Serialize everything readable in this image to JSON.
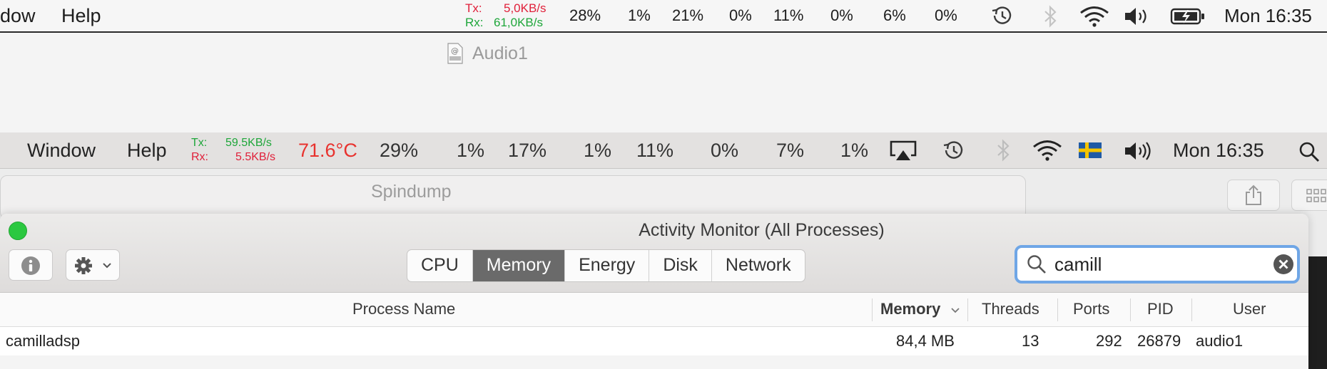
{
  "outer_menubar": {
    "items": [
      "dow",
      "Help"
    ],
    "net": {
      "tx_label": "Tx:",
      "tx_value": "5,0KB/s",
      "rx_label": "Rx:",
      "rx_value": "61,0KB/s"
    },
    "stats": [
      "28%",
      "1%",
      "21%",
      "0%",
      "11%",
      "0%",
      "6%",
      "0%"
    ],
    "clock": "Mon 16:35"
  },
  "vnc_window": {
    "title": "Audio1"
  },
  "remote_menubar": {
    "items": [
      "Window",
      "Help"
    ],
    "net": {
      "tx_label": "Tx:",
      "tx_value": "59.5KB/s",
      "rx_label": "Rx:",
      "rx_value": "5.5KB/s"
    },
    "temperature": "71.6°C",
    "stats": [
      "29%",
      "1%",
      "17%",
      "1%",
      "11%",
      "0%",
      "7%",
      "1%"
    ],
    "clock": "Mon 16:35"
  },
  "spindump_window": {
    "title": "Spindump"
  },
  "activity_monitor": {
    "title": "Activity Monitor (All Processes)",
    "tabs": [
      {
        "label": "CPU",
        "active": false
      },
      {
        "label": "Memory",
        "active": true
      },
      {
        "label": "Energy",
        "active": false
      },
      {
        "label": "Disk",
        "active": false
      },
      {
        "label": "Network",
        "active": false
      }
    ],
    "search": {
      "value": "camill"
    },
    "columns": {
      "process_name": "Process Name",
      "memory": "Memory",
      "threads": "Threads",
      "ports": "Ports",
      "pid": "PID",
      "user": "User"
    },
    "rows": [
      {
        "process_name": "camilladsp",
        "memory": "84,4 MB",
        "threads": "13",
        "ports": "292",
        "pid": "26879",
        "user": "audio1"
      }
    ]
  },
  "colors": {
    "tx_red": "#e0203a",
    "rx_green": "#1ea63a",
    "temperature_red": "#e8322e",
    "active_tab": "#6a6a6a",
    "search_focus": "#6fa6e6",
    "zoom_green": "#2bc840"
  }
}
